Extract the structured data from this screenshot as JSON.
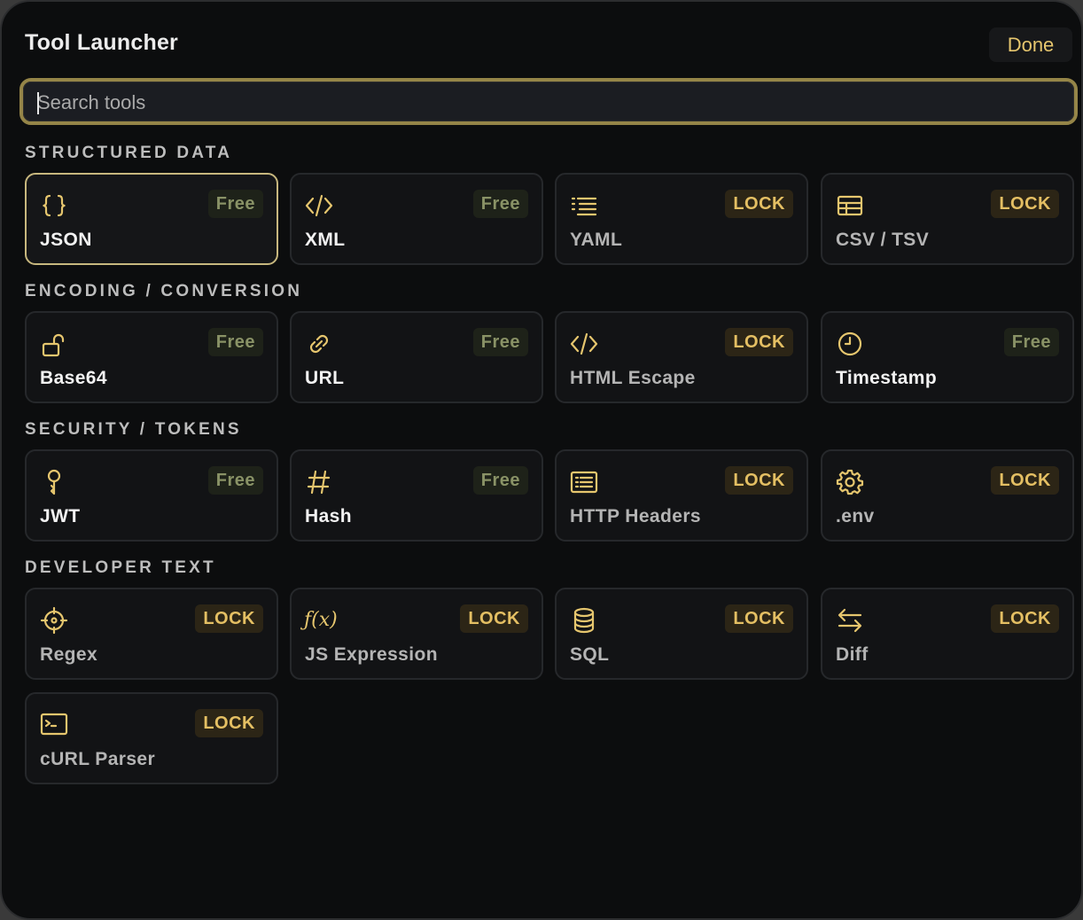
{
  "window": {
    "title": "Tool Launcher",
    "done_label": "Done"
  },
  "search": {
    "placeholder": "Search tools",
    "value": ""
  },
  "sections": [
    {
      "title": "STRUCTURED DATA",
      "tools": [
        {
          "label": "JSON",
          "badge": "Free",
          "icon": "braces-icon",
          "selected": true
        },
        {
          "label": "XML",
          "badge": "Free",
          "icon": "code-icon"
        },
        {
          "label": "YAML",
          "badge": "LOCK",
          "icon": "list-indent-icon"
        },
        {
          "label": "CSV / TSV",
          "badge": "LOCK",
          "icon": "table-icon"
        }
      ]
    },
    {
      "title": "ENCODING / CONVERSION",
      "tools": [
        {
          "label": "Base64",
          "badge": "Free",
          "icon": "unlock-icon"
        },
        {
          "label": "URL",
          "badge": "Free",
          "icon": "link-icon"
        },
        {
          "label": "HTML Escape",
          "badge": "LOCK",
          "icon": "code-icon"
        },
        {
          "label": "Timestamp",
          "badge": "Free",
          "icon": "clock-icon"
        }
      ]
    },
    {
      "title": "SECURITY / TOKENS",
      "tools": [
        {
          "label": "JWT",
          "badge": "Free",
          "icon": "key-icon"
        },
        {
          "label": "Hash",
          "badge": "Free",
          "icon": "hash-icon"
        },
        {
          "label": "HTTP Headers",
          "badge": "LOCK",
          "icon": "document-list-icon"
        },
        {
          "label": ".env",
          "badge": "LOCK",
          "icon": "gear-icon"
        }
      ]
    },
    {
      "title": "DEVELOPER TEXT",
      "tools": [
        {
          "label": "Regex",
          "badge": "LOCK",
          "icon": "crosshair-icon"
        },
        {
          "label": "JS Expression",
          "badge": "LOCK",
          "icon": "function-icon",
          "icon_text": "ƒ(x)"
        },
        {
          "label": "SQL",
          "badge": "LOCK",
          "icon": "database-icon"
        },
        {
          "label": "Diff",
          "badge": "LOCK",
          "icon": "swap-arrows-icon"
        },
        {
          "label": "cURL Parser",
          "badge": "LOCK",
          "icon": "terminal-icon"
        }
      ]
    }
  ],
  "colors": {
    "accent": "#e6c66e",
    "selected_border": "#c7b77e",
    "free_badge_text": "#899266",
    "lock_badge_text": "#e4bf63",
    "background": "#0c0d0e"
  }
}
